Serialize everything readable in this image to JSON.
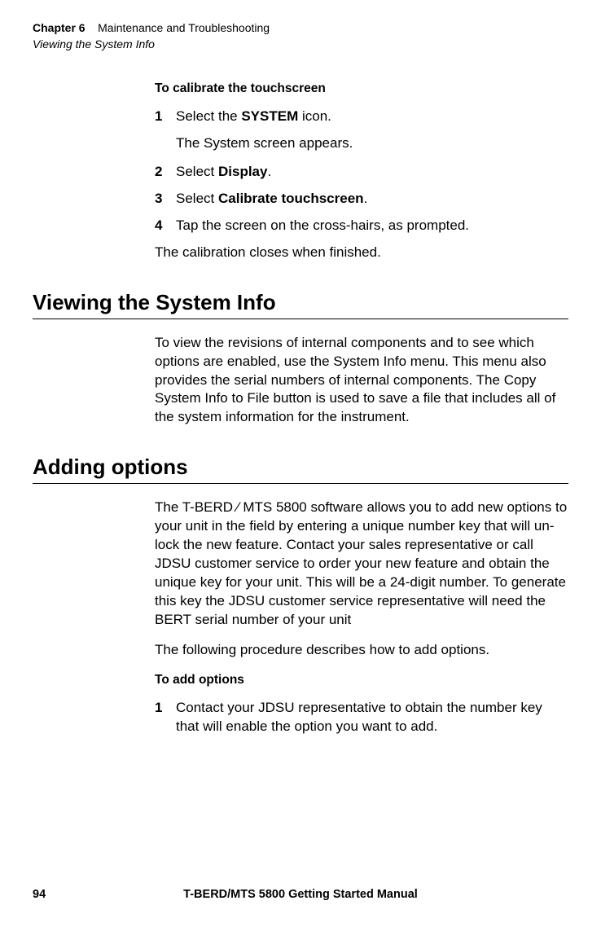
{
  "header": {
    "chapter_prefix": "Chapter 6",
    "chapter_title": "Maintenance and Troubleshooting",
    "section": "Viewing the System Info"
  },
  "calibrate": {
    "proc_title": "To calibrate the touchscreen",
    "steps": {
      "n1": "1",
      "s1a": "Select the ",
      "s1b": "SYSTEM",
      "s1c": " icon.",
      "s1_sub": "The System screen appears.",
      "n2": "2",
      "s2a": "Select ",
      "s2b": "Display",
      "s2c": ".",
      "n3": "3",
      "s3a": "Select ",
      "s3b": "Calibrate touchscreen",
      "s3c": ".",
      "n4": "4",
      "s4": "Tap the screen on the cross-hairs, as prompted."
    },
    "after": "The calibration closes when finished."
  },
  "viewing": {
    "heading": "Viewing the System Info",
    "body": "To view the revisions of internal components and to see which options are enabled, use the System Info menu. This menu also provides the serial numbers of internal components. The Copy System Info to File button is used to save a file that includes all of the system information for the instrument."
  },
  "adding": {
    "heading": "Adding options",
    "body1": "The T-BERD ⁄ MTS 5800 software allows you to add new options to your unit in the field by entering a unique number key that will un-lock the new feature. Contact your sales repre­sentative or call JDSU customer service to order your new feature and obtain the unique key for your unit. This will be a 24-digit number. To generate this key the JDSU customer service representative will need the BERT serial number of your unit",
    "body2": "The following procedure describes how to add options.",
    "proc_title": "To add options",
    "steps": {
      "n1": "1",
      "s1": "Contact your JDSU representative to obtain the number key that will enable the option you want to add."
    }
  },
  "footer": {
    "page": "94",
    "manual": "T-BERD/MTS 5800 Getting Started Manual"
  }
}
